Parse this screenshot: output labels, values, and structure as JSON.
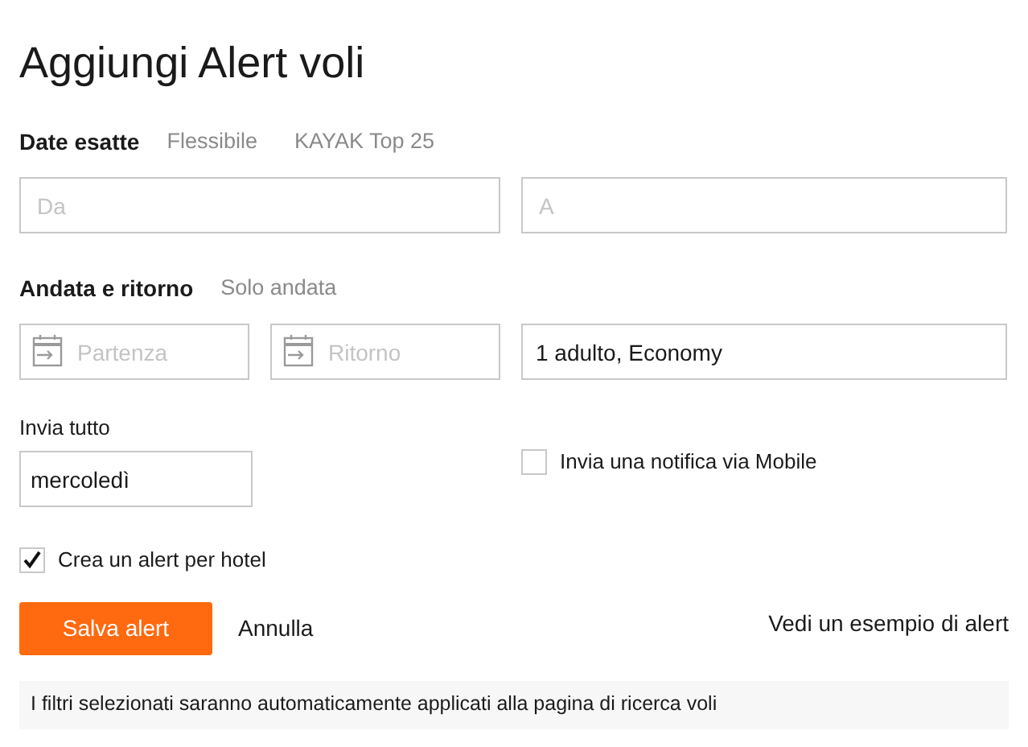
{
  "title": "Aggiungi Alert voli",
  "date_tabs": [
    {
      "label": "Date esatte",
      "selected": true
    },
    {
      "label": "Flessibile",
      "selected": false
    },
    {
      "label": "KAYAK Top 25",
      "selected": false
    }
  ],
  "date_fields": [
    {
      "placeholder": "Da"
    },
    {
      "placeholder": "A"
    }
  ],
  "trip_tabs": [
    {
      "label": "Andata e ritorno",
      "selected": true
    },
    {
      "label": "Solo andata",
      "selected": false
    }
  ],
  "date_pickers": [
    {
      "placeholder": "Partenza"
    },
    {
      "placeholder": "Ritorno"
    }
  ],
  "passengers": {
    "value": "1 adulto, Economy"
  },
  "frequency": {
    "label": "Invia tutto",
    "value": "mercoledì"
  },
  "mobile_notification": {
    "label": "Invia una notifica via Mobile",
    "checked": false
  },
  "hotel_alert": {
    "label": "Crea un alert per hotel",
    "checked": true
  },
  "save_button": "Salva alert",
  "cancel_link": "Annulla",
  "example_link": "Vedi un esempio di alert",
  "info_text": "I filtri selezionati saranno automaticamente applicati alla pagina di ricerca voli"
}
